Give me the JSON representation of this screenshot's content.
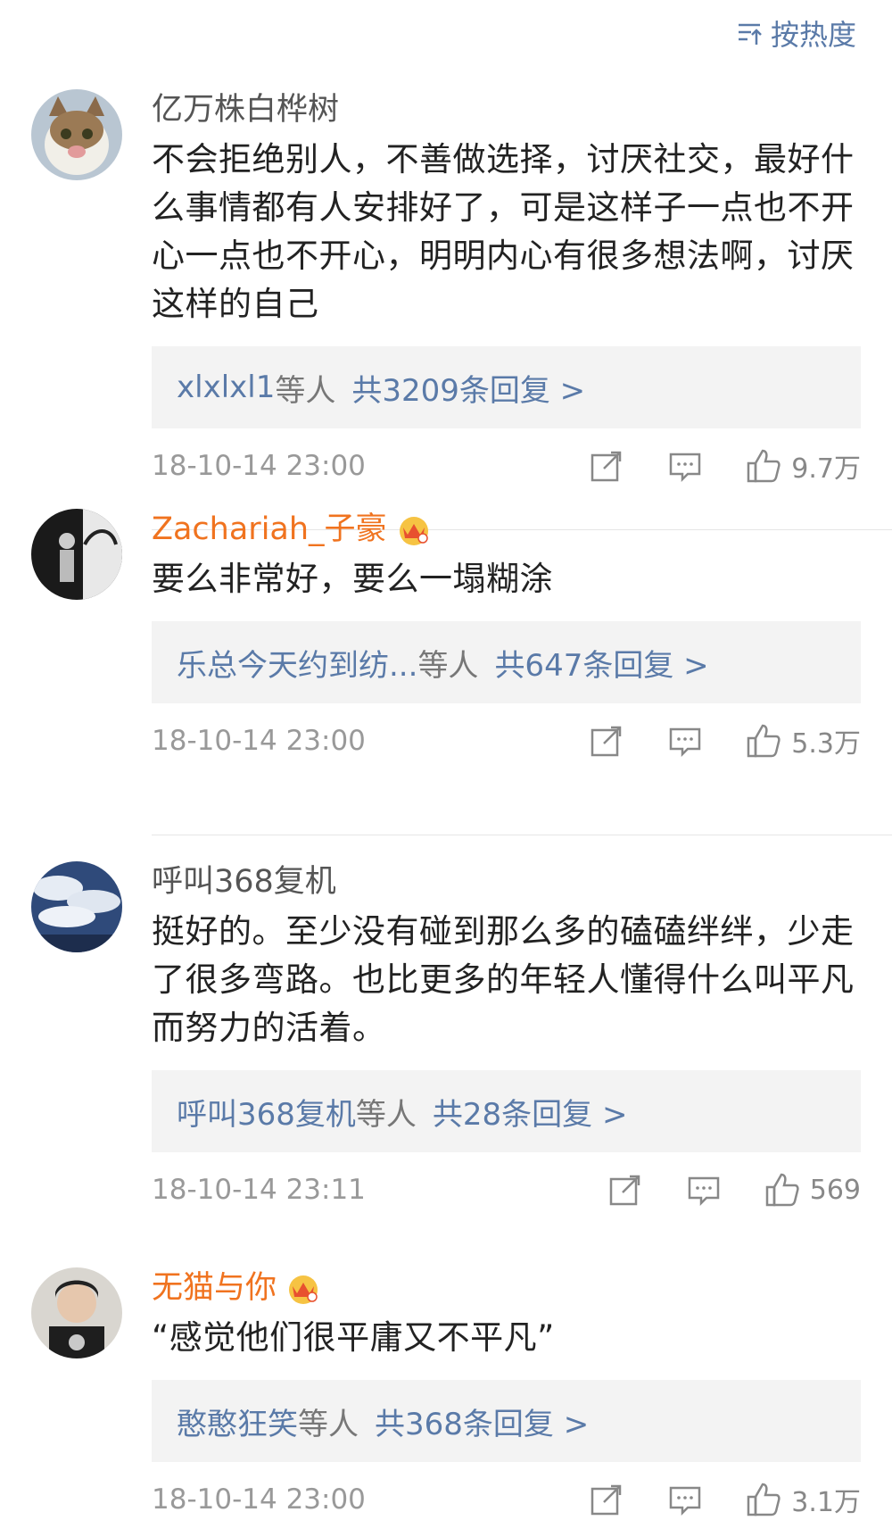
{
  "sort": {
    "label": "按热度"
  },
  "comments": [
    {
      "username": "亿万株白桦树",
      "vip": false,
      "text": "不会拒绝别人，不善做选择，讨厌社交，最好什么事情都有人安排好了，可是这样子一点也不开心一点也不开心，明明内心有很多想法啊，讨厌这样的自己",
      "reply_users": "xlxlxl1",
      "reply_mid": "等人",
      "reply_count": "共3209条回复 >",
      "time": "18-10-14 23:00",
      "likes": "9.7万"
    },
    {
      "username": "Zachariah_子豪",
      "vip": true,
      "text": "要么非常好，要么一塌糊涂",
      "reply_users": "乐总今天约到纺...",
      "reply_mid": "等人",
      "reply_count": "共647条回复 >",
      "time": "18-10-14 23:00",
      "likes": "5.3万"
    },
    {
      "username": "呼叫368复机",
      "vip": false,
      "text": "挺好的。至少没有碰到那么多的磕磕绊绊，少走了很多弯路。也比更多的年轻人懂得什么叫平凡而努力的活着。",
      "reply_users": "呼叫368复机",
      "reply_mid": "等人",
      "reply_count": "共28条回复 >",
      "time": "18-10-14 23:11",
      "likes": "569"
    },
    {
      "username": "无猫与你",
      "vip": true,
      "text": "“感觉他们很平庸又不平凡”",
      "reply_users": "憨憨狂笑",
      "reply_mid": "等人",
      "reply_count": "共368条回复 >",
      "time": "18-10-14 23:00",
      "likes": "3.1万"
    }
  ],
  "colors": {
    "link": "#5a7aa8",
    "vip_name": "#f0731f",
    "reply_bg": "#f3f3f3"
  },
  "icons": [
    "sort-icon",
    "crown-icon",
    "share-icon",
    "comment-icon",
    "like-icon"
  ]
}
